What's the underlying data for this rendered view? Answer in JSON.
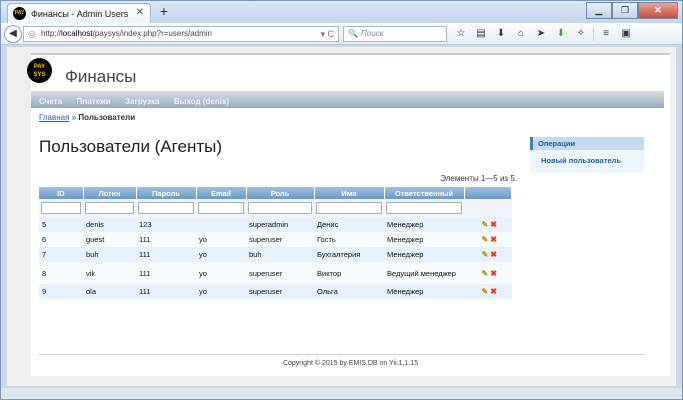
{
  "browser": {
    "tab_title": "Финансы - Admin Users",
    "tab_icon_text": "PAY",
    "new_tab": "+",
    "tab_close": "✕",
    "url_prefix": "http://",
    "url_host": "localhost",
    "url_path": "/paysys/index.php?r=users/admin",
    "search_placeholder": "Поиск"
  },
  "app": {
    "logo_line1": "PAY",
    "logo_line2": "SYS",
    "title": "Финансы",
    "menu": [
      "Счета",
      "Платежи",
      "Загрузка",
      "Выход (denis)"
    ]
  },
  "breadcrumb": {
    "home": "Главная",
    "separator": "»",
    "current": "Пользователи"
  },
  "page": {
    "heading": "Пользователи (Агенты)",
    "summary": "Элементы 1—5 из 5."
  },
  "table": {
    "columns": [
      "ID",
      "Логин",
      "Пароль",
      "Email",
      "Роль",
      "Имя",
      "Ответственный"
    ],
    "rows": [
      {
        "id": "5",
        "login": "denis",
        "password": "123",
        "email": "",
        "role": "superadmin",
        "name": "Денис",
        "responsible": "Менеджер"
      },
      {
        "id": "6",
        "login": "guest",
        "password": "111",
        "email": "yo",
        "role": "superuser",
        "name": "Гость",
        "responsible": "Менеджер"
      },
      {
        "id": "7",
        "login": "buh",
        "password": "111",
        "email": "yo",
        "role": "buh",
        "name": "Бухгалтерия",
        "responsible": "Менеджер"
      },
      {
        "id": "8",
        "login": "vik",
        "password": "111",
        "email": "yo",
        "role": "superuser",
        "name": "Виктор",
        "responsible": "Ведущий менеджер"
      },
      {
        "id": "9",
        "login": "ola",
        "password": "111",
        "email": "yo",
        "role": "superuser",
        "name": "Ольга",
        "responsible": "Менеджер"
      }
    ]
  },
  "operations": {
    "header": "Операции",
    "items": [
      "Новый пользователь"
    ]
  },
  "footer": {
    "text": "Copyright © 2015 by EMIS.DB on Yii.1.1.15"
  }
}
